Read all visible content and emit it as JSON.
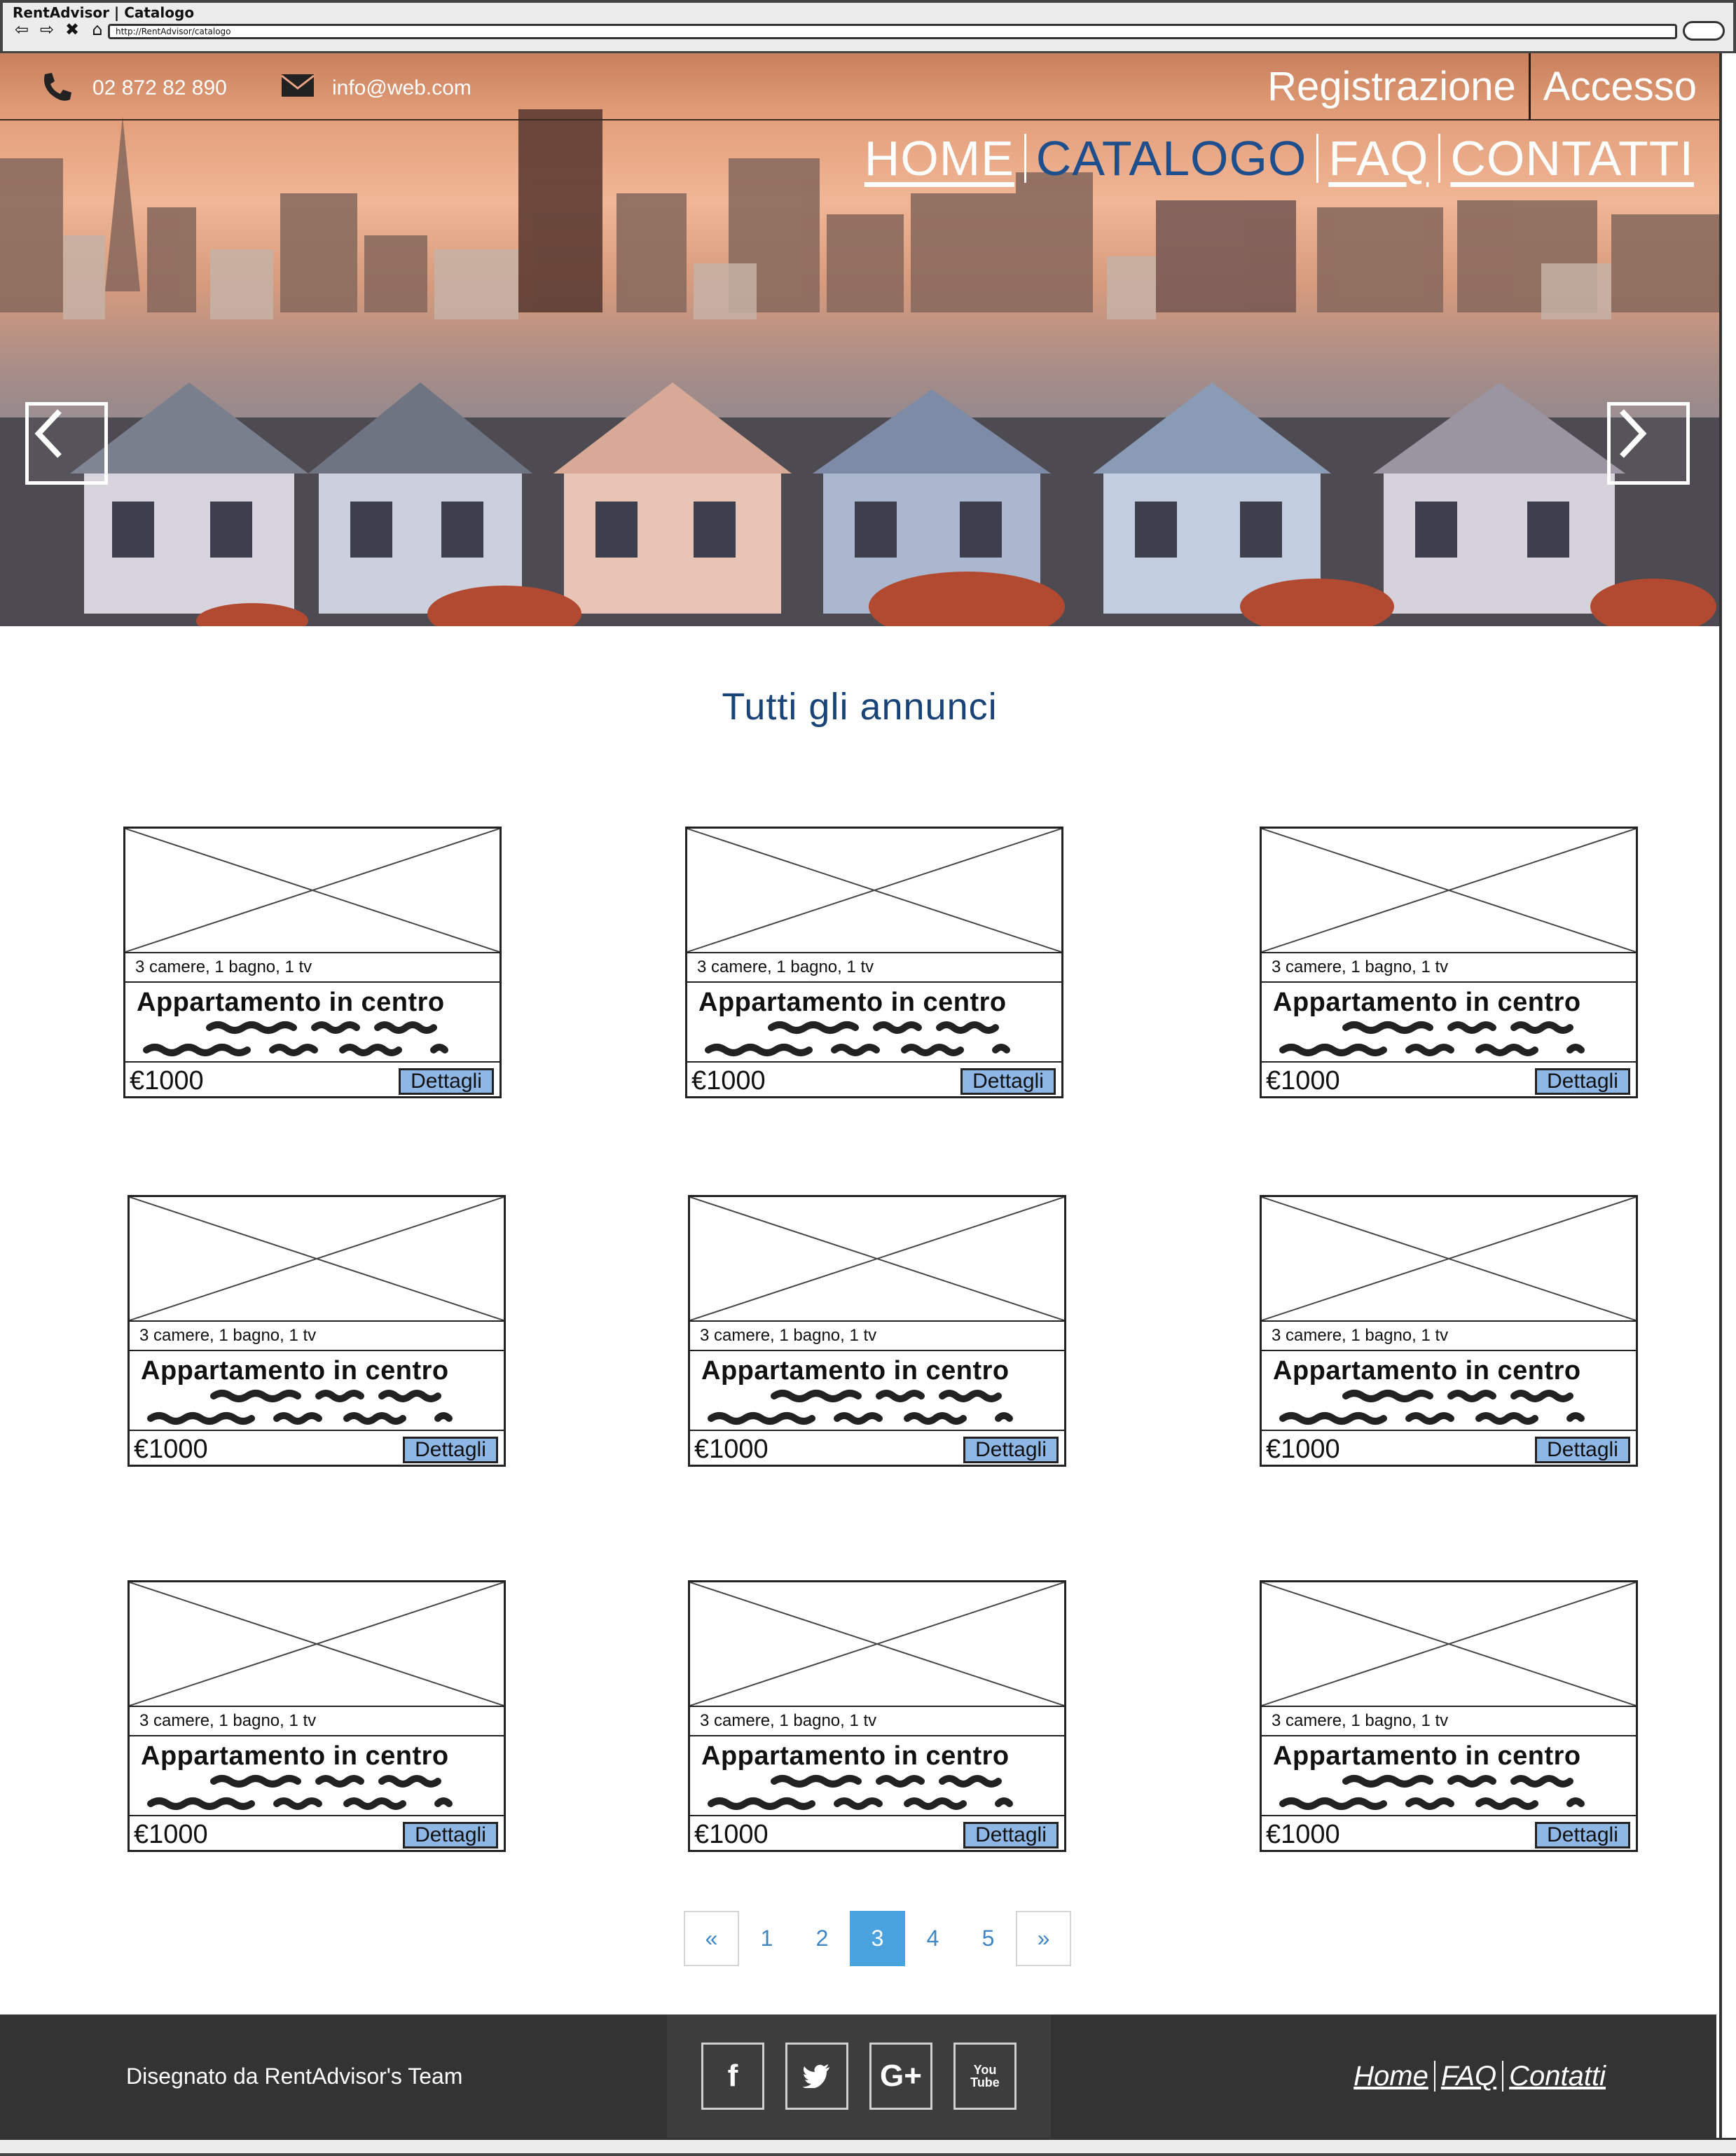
{
  "browser": {
    "window_title": "RentAdvisor | Catalogo",
    "url": "http://RentAdvisor/catalogo"
  },
  "header": {
    "phone": "02 872 82 890",
    "email": "info@web.com",
    "auth": {
      "register": "Registrazione",
      "login": "Accesso"
    },
    "nav": [
      {
        "label": "HOME",
        "active": false
      },
      {
        "label": "CATALOGO",
        "active": true
      },
      {
        "label": "FAQ",
        "active": false
      },
      {
        "label": "CONTATTI",
        "active": false
      }
    ],
    "carousel": {
      "prev_icon": "chevron-left-icon",
      "next_icon": "chevron-right-icon"
    }
  },
  "main": {
    "title": "Tutti gli annunci",
    "listings": [
      {
        "specs": "3 camere, 1 bagno, 1 tv",
        "title": "Appartamento in centro",
        "price": "€1000",
        "button": "Dettagli"
      },
      {
        "specs": "3 camere, 1 bagno, 1 tv",
        "title": "Appartamento in centro",
        "price": "€1000",
        "button": "Dettagli"
      },
      {
        "specs": "3 camere, 1 bagno, 1 tv",
        "title": "Appartamento in centro",
        "price": "€1000",
        "button": "Dettagli"
      },
      {
        "specs": "3 camere, 1 bagno, 1 tv",
        "title": "Appartamento in centro",
        "price": "€1000",
        "button": "Dettagli"
      },
      {
        "specs": "3 camere, 1 bagno, 1 tv",
        "title": "Appartamento in centro",
        "price": "€1000",
        "button": "Dettagli"
      },
      {
        "specs": "3 camere, 1 bagno, 1 tv",
        "title": "Appartamento in centro",
        "price": "€1000",
        "button": "Dettagli"
      },
      {
        "specs": "3 camere, 1 bagno, 1 tv",
        "title": "Appartamento in centro",
        "price": "€1000",
        "button": "Dettagli"
      },
      {
        "specs": "3 camere, 1 bagno, 1 tv",
        "title": "Appartamento in centro",
        "price": "€1000",
        "button": "Dettagli"
      },
      {
        "specs": "3 camere, 1 bagno, 1 tv",
        "title": "Appartamento in centro",
        "price": "€1000",
        "button": "Dettagli"
      }
    ],
    "pagination": {
      "prev": "«",
      "pages": [
        "1",
        "2",
        "3",
        "4",
        "5"
      ],
      "current": "3",
      "next": "»"
    }
  },
  "footer": {
    "credit": "Disegnato da RentAdvisor's Team",
    "social": [
      {
        "icon": "facebook-icon",
        "glyph": "f"
      },
      {
        "icon": "twitter-icon",
        "glyph": "🐦"
      },
      {
        "icon": "google-plus-icon",
        "glyph": "G+"
      },
      {
        "icon": "youtube-icon",
        "glyph": "You Tube"
      }
    ],
    "links": [
      "Home",
      "FAQ",
      "Contatti"
    ]
  },
  "colors": {
    "nav_active": "#1f4e8c",
    "title": "#1a4478",
    "button": "#8fb7e6",
    "pagination_active": "#4aa3df",
    "footer_bg": "#333333"
  }
}
